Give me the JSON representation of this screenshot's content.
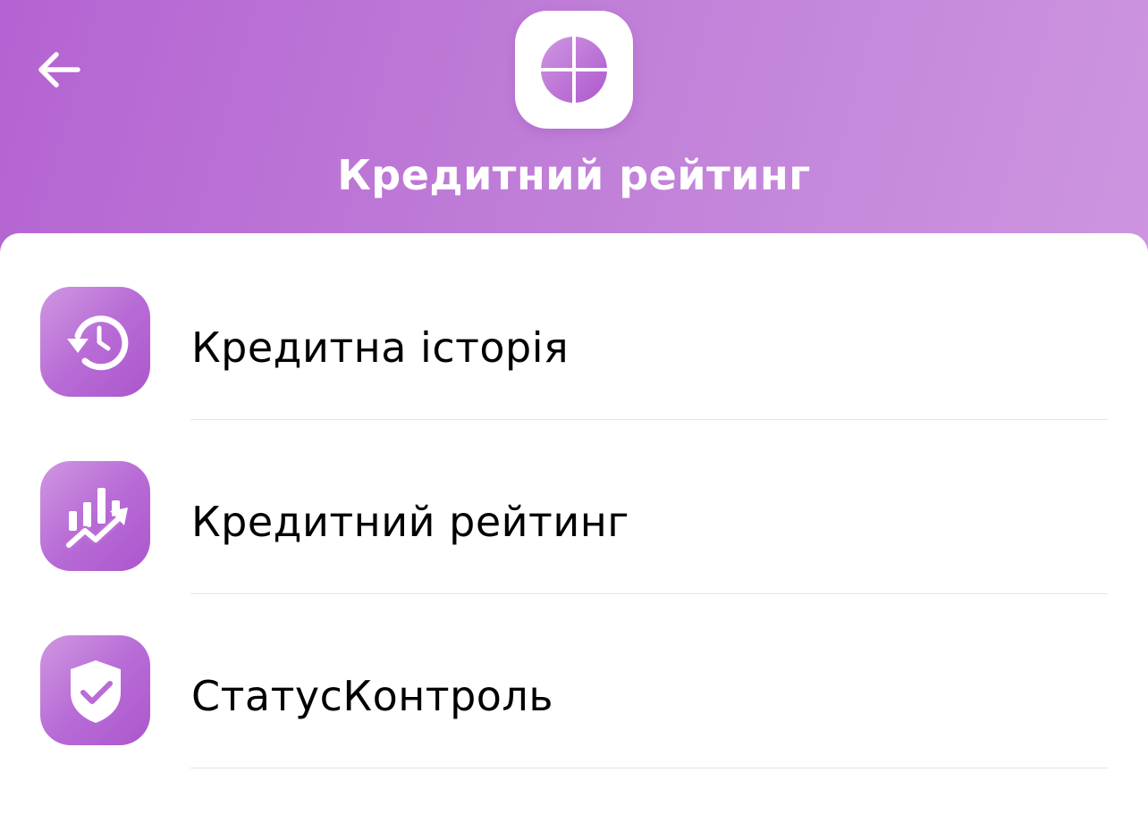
{
  "colors": {
    "brand_gradient_start": "#b463d2",
    "brand_gradient_end": "#cd95e0",
    "icon_tile": "#bb70d7",
    "text": "#000000",
    "divider": "#e6e6e9"
  },
  "header": {
    "back_icon": "arrow-left-icon",
    "logo_icon": "circle-cross-logo-icon",
    "title": "Кредитний рейтинг"
  },
  "menu": {
    "items": [
      {
        "label": "Кредитна історія",
        "icon": "history-clock-icon"
      },
      {
        "label": "Кредитний рейтинг",
        "icon": "rating-chart-icon"
      },
      {
        "label": "СтатусКонтроль",
        "icon": "shield-check-icon"
      }
    ]
  }
}
